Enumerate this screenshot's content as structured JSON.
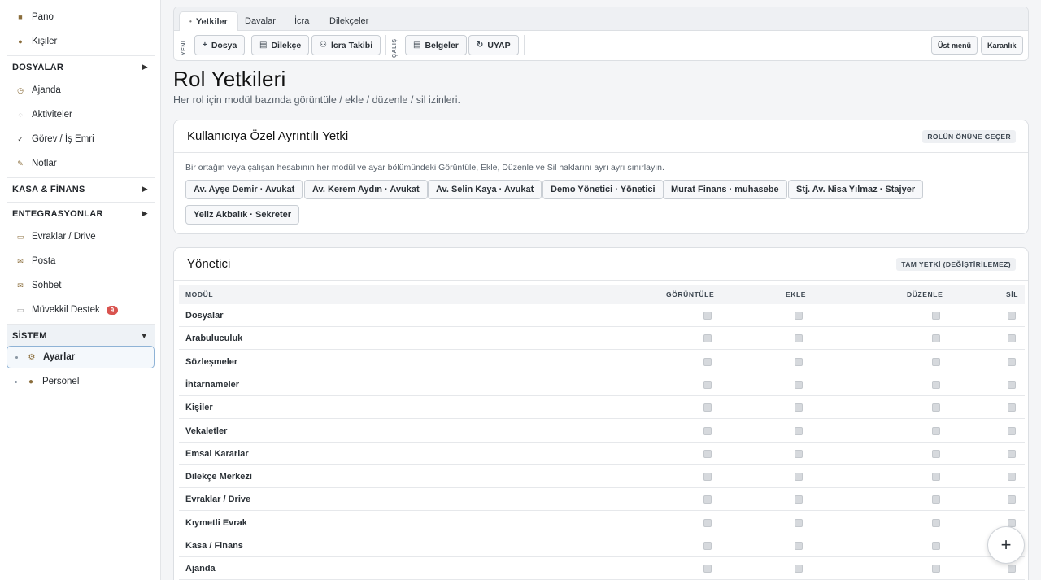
{
  "sidebar": {
    "top_items": [
      {
        "label": "Pano",
        "icon": "dashboard-icon"
      },
      {
        "label": "Kişiler",
        "icon": "contacts-icon"
      }
    ],
    "sections": [
      {
        "label": "DOSYALAR",
        "arrow": "▶"
      },
      {
        "label": "KASA & FİNANS",
        "arrow": "▶"
      },
      {
        "label": "ENTEGRASYONLAR",
        "arrow": "▶"
      },
      {
        "label": "SİSTEM",
        "arrow": "▼"
      }
    ],
    "dosyalar_items": [
      {
        "label": "Ajanda",
        "icon": "clock-icon"
      },
      {
        "label": "Aktiviteler",
        "icon": "activity-icon"
      },
      {
        "label": "Görev / İş Emri",
        "icon": "check-icon"
      },
      {
        "label": "Notlar",
        "icon": "pencil-icon"
      }
    ],
    "integration_items": [
      {
        "label": "Evraklar / Drive",
        "icon": "folder-icon"
      },
      {
        "label": "Posta",
        "icon": "mail-icon"
      },
      {
        "label": "Sohbet",
        "icon": "chat-icon"
      },
      {
        "label": "Müvekkil Destek",
        "icon": "support-icon",
        "badge": "9"
      }
    ],
    "system_items": [
      {
        "label": "Ayarlar",
        "icon": "gear-icon",
        "active": true
      },
      {
        "label": "Personel",
        "icon": "staff-icon"
      }
    ]
  },
  "tabs": [
    "Yetkiler",
    "Davalar",
    "İcra",
    "Dilekçeler"
  ],
  "toolbar": {
    "new_label": "YENİ",
    "work_label": "ÇALIŞ",
    "dosya": "Dosya",
    "dilekce": "Dilekçe",
    "icra_takibi": "İcra Takibi",
    "belgeler": "Belgeler",
    "uyap": "UYAP",
    "top_menu": "Üst menü",
    "dark": "Karanlık"
  },
  "page": {
    "title": "Rol Yetkileri",
    "subtitle": "Her rol için modül bazında görüntüle / ekle / düzenle / sil izinleri."
  },
  "user_card": {
    "title": "Kullanıcıya Özel Ayrıntılı Yetki",
    "tag": "ROLÜN ÖNÜNE GEÇER",
    "desc": "Bir ortağın veya çalışan hesabının her modül ve ayar bölümündeki Görüntüle, Ekle, Düzenle ve Sil haklarını ayrı ayrı sınırlayın.",
    "users": [
      "Av. Ayşe Demir · Avukat",
      "Av. Kerem Aydın · Avukat",
      "Av. Selin Kaya · Avukat",
      "Demo Yönetici · Yönetici",
      "Murat Finans · muhasebe",
      "Stj. Av. Nisa Yılmaz · Stajyer",
      "Yeliz Akbalık · Sekreter"
    ]
  },
  "role_card": {
    "title": "Yönetici",
    "tag": "TAM YETKİ (DEĞİŞTİRİLEMEZ)",
    "columns": [
      "MODÜL",
      "GÖRÜNTÜLE",
      "EKLE",
      "DÜZENLE",
      "SİL"
    ],
    "rows": [
      "Dosyalar",
      "Arabuluculuk",
      "Sözleşmeler",
      "İhtarnameler",
      "Kişiler",
      "Vekaletler",
      "Emsal Kararlar",
      "Dilekçe Merkezi",
      "Evraklar / Drive",
      "Kıymetli Evrak",
      "Kasa / Finans",
      "Ajanda"
    ]
  },
  "fab": "+"
}
